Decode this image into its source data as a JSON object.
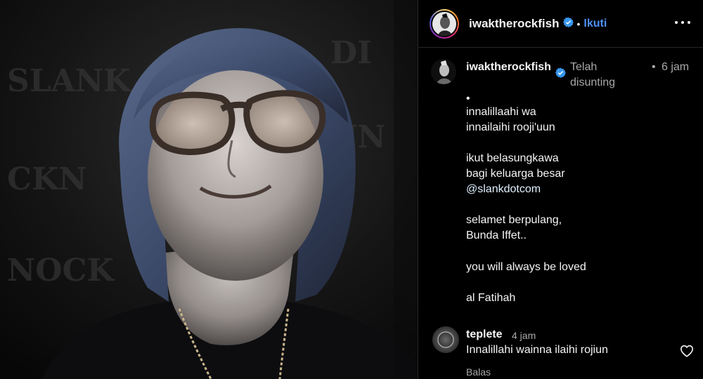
{
  "post": {
    "username": "iwaktherockfish",
    "follow_label": "Ikuti",
    "separator": "•"
  },
  "caption": {
    "username": "iwaktherockfish",
    "edited_label": "Telah disunting",
    "separator": "•",
    "time": "6 jam",
    "bullet": "•",
    "lines": [
      "innalillaahi wa",
      "innailaihi rooji'uun",
      "ikut belasungkawa",
      "bagi keluarga besar",
      "@slankdotcom",
      "selamet berpulang,",
      "Bunda Iffet..",
      "you will always be loved",
      "al Fatihah"
    ]
  },
  "comment": {
    "username": "teplete",
    "time": "4 jam",
    "text": "Innalillahi wainna ilaihi rojiun",
    "reply_label": "Balas"
  },
  "colors": {
    "link": "#4f8ff7",
    "verified": "#3797f0",
    "muted": "#a8a8a8"
  }
}
